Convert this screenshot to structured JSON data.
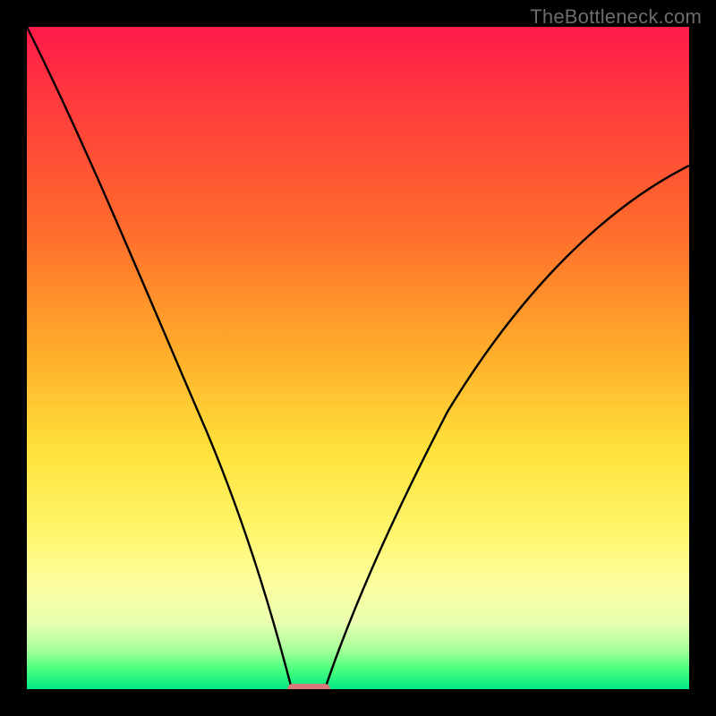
{
  "watermark": {
    "text": "TheBottleneck.com"
  },
  "chart_data": {
    "type": "line",
    "title": "",
    "xlabel": "",
    "ylabel": "",
    "xlim": [
      0,
      100
    ],
    "ylim": [
      0,
      100
    ],
    "grid": false,
    "legend": false,
    "marker": {
      "x_center": 42.5,
      "width": 6,
      "y": 0,
      "color": "#d67a7a"
    },
    "background_gradient_stops": [
      {
        "pos": 0,
        "color": "#ff1a4a"
      },
      {
        "pos": 12,
        "color": "#ff3c3c"
      },
      {
        "pos": 30,
        "color": "#ff6a2c"
      },
      {
        "pos": 48,
        "color": "#ffa92a"
      },
      {
        "pos": 64,
        "color": "#ffe23a"
      },
      {
        "pos": 76,
        "color": "#fff66a"
      },
      {
        "pos": 84,
        "color": "#fdff9e"
      },
      {
        "pos": 90,
        "color": "#e8ffb0"
      },
      {
        "pos": 94,
        "color": "#a8ff9a"
      },
      {
        "pos": 97,
        "color": "#4bff7e"
      },
      {
        "pos": 100,
        "color": "#00e884"
      }
    ],
    "series": [
      {
        "name": "left-curve",
        "x": [
          0,
          5,
          10,
          15,
          20,
          25,
          30,
          33,
          36,
          38,
          40
        ],
        "y": [
          100,
          90,
          79,
          67,
          55,
          42,
          29,
          20,
          12,
          6,
          0
        ]
      },
      {
        "name": "right-curve",
        "x": [
          45,
          48,
          52,
          56,
          60,
          66,
          72,
          78,
          85,
          92,
          100
        ],
        "y": [
          0,
          6,
          14,
          22,
          30,
          40,
          49,
          57,
          65,
          72,
          79
        ]
      }
    ]
  }
}
